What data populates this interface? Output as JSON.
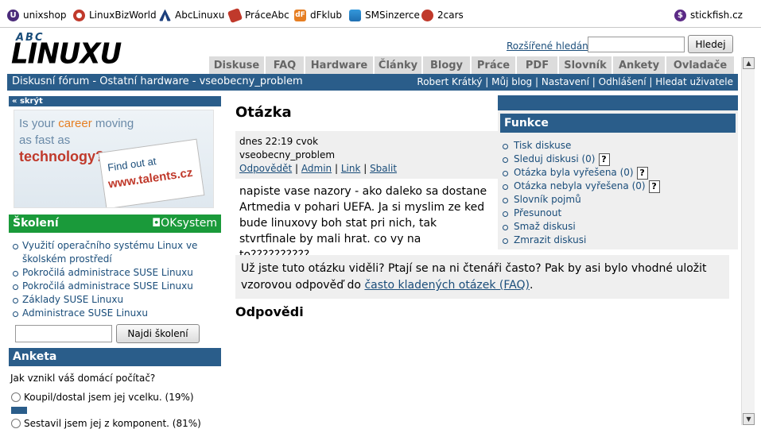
{
  "partners": [
    {
      "label": "unixshop",
      "icon": "unixshop-icon"
    },
    {
      "label": "LinuxBizWorld",
      "icon": "linuxbizworld-icon"
    },
    {
      "label": "AbcLinuxu",
      "icon": "abclinuxu-icon"
    },
    {
      "label": "PráceAbc",
      "icon": "praceabc-icon"
    },
    {
      "label": "dFklub",
      "icon": "dfklub-icon"
    },
    {
      "label": "SMSinzerce",
      "icon": "smsinzerce-icon"
    },
    {
      "label": "2cars",
      "icon": "2cars-icon"
    },
    {
      "label": "stickfish.cz",
      "icon": "stickfish-icon"
    }
  ],
  "header": {
    "logo_top": "ABC",
    "logo_main": "LINUXU",
    "advanced_search": "Rozšířené hledání",
    "search_placeholder": "",
    "search_button": "Hledej"
  },
  "tabs": [
    "Diskuse",
    "FAQ",
    "Hardware",
    "Články",
    "Blogy",
    "Práce",
    "PDF",
    "Slovník",
    "Ankety",
    "Ovladače"
  ],
  "breadcrumb": "Diskusní fórum - Ostatní hardware - vseobecny_problem",
  "user_links": [
    "Robert Krátký",
    "Můj blog",
    "Nastavení",
    "Odhlášení",
    "Hledat uživatele"
  ],
  "sidebar": {
    "hide_label": "skrýt",
    "banner": {
      "line1a": "Is your ",
      "line1b": "career",
      "line1c": " moving",
      "line2": "as fast as",
      "line3": "technology?",
      "board1": "Find out at",
      "board2": "www.talents.cz"
    },
    "skoleni_title": "Školení",
    "skoleni_brand": "OKsystem",
    "skoleni_items": [
      "Využití operačního systému Linux ve školském prostředí",
      "Pokročilá administrace SUSE Linuxu",
      "Pokročilá administrace SUSE Linuxu",
      "Základy SUSE Linuxu",
      "Administrace SUSE Linuxu"
    ],
    "skoleni_button": "Najdi školení",
    "anketa_title": "Anketa",
    "anketa_question": "Jak vznikl váš domácí počítač?",
    "anketa_options": [
      {
        "label": "Koupil/dostal jsem jej vcelku. (19%)",
        "percent": 19
      },
      {
        "label": "Sestavil jsem jej z komponent. (81%)",
        "percent": 81
      }
    ]
  },
  "question": {
    "title": "Otázka",
    "date": "dnes 22:19 cvok",
    "subject": "vseobecny_problem",
    "actions": [
      "Odpovědět",
      "Admin",
      "Link",
      "Sbalit"
    ],
    "body": "napiste vase nazory - ako daleko sa dostane Artmedia v pohari UEFA. Ja si myslim ze ked bude linuxovy boh stat pri nich, tak stvrtfinale by mali hrat. co vy na to??????????"
  },
  "faq_notice": {
    "text": "Už jste tuto otázku viděli? Ptají se na ni čtenáři často? Pak by asi bylo vhodné uložit vzorovou odpověď do ",
    "link": "často kladených otázek (FAQ)",
    "end": "."
  },
  "answers_title": "Odpovědi",
  "funkce": {
    "title": "Funkce",
    "items": [
      {
        "label": "Tisk diskuse",
        "help": false
      },
      {
        "label": "Sleduj diskusi (0)",
        "help": true
      },
      {
        "label": "Otázka byla vyřešena (0)",
        "help": true
      },
      {
        "label": "Otázka nebyla vyřešena (0)",
        "help": true
      },
      {
        "label": "Slovník pojmů",
        "help": false
      },
      {
        "label": "Přesunout",
        "help": false
      },
      {
        "label": "Smaž diskusi",
        "help": false
      },
      {
        "label": "Zmrazit diskusi",
        "help": false
      }
    ],
    "help_glyph": "?"
  },
  "colors": {
    "header_blue": "#2a5d8a",
    "skoleni_green": "#1a9a3a",
    "link_blue": "#1a4d7a",
    "panel_gray": "#efefef"
  }
}
